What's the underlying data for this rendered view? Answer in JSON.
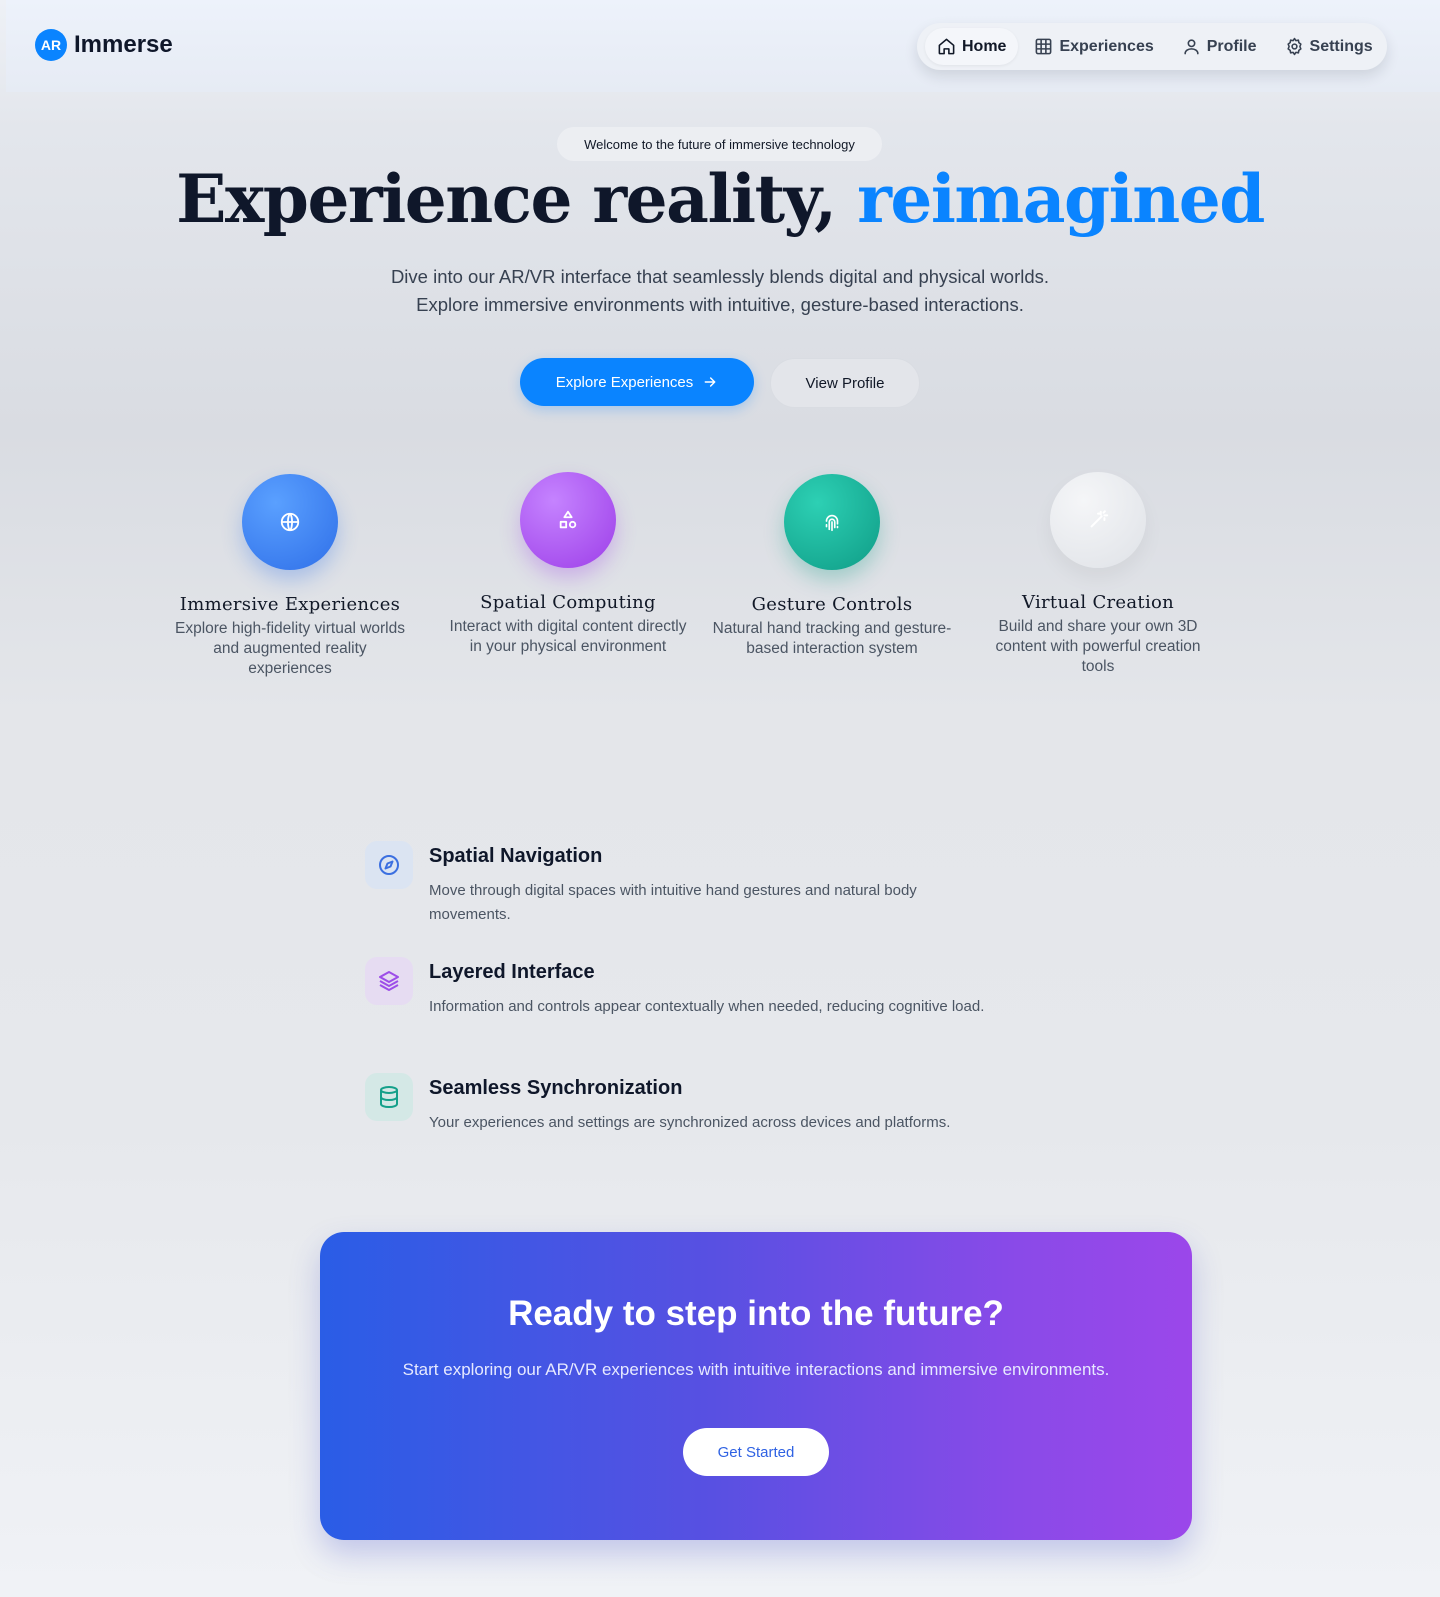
{
  "brand": {
    "badge": "AR",
    "name": "Immerse",
    "accent": "#0a84ff"
  },
  "nav": {
    "items": [
      {
        "label": "Home",
        "icon": "home-icon",
        "active": true
      },
      {
        "label": "Experiences",
        "icon": "grid-icon",
        "active": false
      },
      {
        "label": "Profile",
        "icon": "user-icon",
        "active": false
      },
      {
        "label": "Settings",
        "icon": "gear-icon",
        "active": false
      }
    ]
  },
  "hero": {
    "pill": "Welcome to the future of immersive technology",
    "title_main": "Experience reality, ",
    "title_accent": "reimagined",
    "subtitle_line1": "Dive into our AR/VR interface that seamlessly blends digital and physical worlds.",
    "subtitle_line2": "Explore immersive environments with intuitive, gesture-based interactions.",
    "primary_button": "Explore Experiences",
    "secondary_button": "View Profile"
  },
  "features": [
    {
      "title": "Immersive Experiences",
      "desc": "Explore high-fidelity virtual worlds and augmented reality experiences",
      "icon": "globe-icon",
      "color": "#2f6fe8"
    },
    {
      "title": "Spatial Computing",
      "desc": "Interact with digital content directly in your physical environment",
      "icon": "shapes-icon",
      "color": "#9d3ee8"
    },
    {
      "title": "Gesture Controls",
      "desc": "Natural hand tracking and gesture-based interaction system",
      "icon": "fingerprint-icon",
      "color": "#0f9c86"
    },
    {
      "title": "Virtual Creation",
      "desc": "Build and share your own 3D content with powerful creation tools",
      "icon": "magic-wand-icon",
      "color": "#dfe2e7"
    }
  ],
  "highlights": [
    {
      "title": "Spatial Navigation",
      "desc": "Move through digital spaces with intuitive hand gestures and natural body movements.",
      "icon": "compass-icon",
      "color": "#3b6fe0"
    },
    {
      "title": "Layered Interface",
      "desc": "Information and controls appear contextually when needed, reducing cognitive load.",
      "icon": "layers-icon",
      "color": "#9d4ee8"
    },
    {
      "title": "Seamless Synchronization",
      "desc": "Your experiences and settings are synchronized across devices and platforms.",
      "icon": "database-icon",
      "color": "#14a08a"
    }
  ],
  "cta": {
    "title": "Ready to step into the future?",
    "subtitle": "Start exploring our AR/VR experiences with intuitive interactions and immersive environments.",
    "button": "Get Started"
  }
}
